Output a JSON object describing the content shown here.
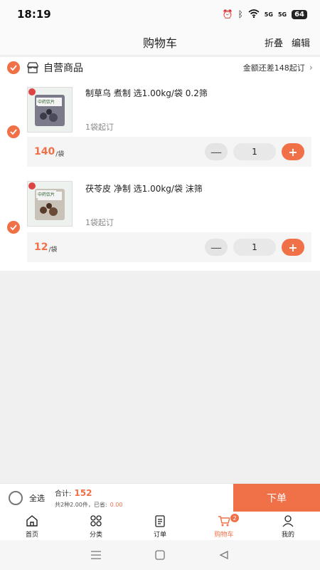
{
  "status": {
    "time": "18:19",
    "battery": "64",
    "net1": "5G",
    "net2": "5G"
  },
  "header": {
    "title": "购物车",
    "fold_label": "折叠",
    "edit_label": "编辑"
  },
  "store": {
    "name": "自营商品",
    "hint": "金额还差148起订"
  },
  "items": [
    {
      "name": "制草乌 煮制 选1.00kg/袋 0.2筛",
      "moq": "1袋起订",
      "price": "140",
      "unit": "/袋",
      "qty": "1",
      "thumb_label": "中药饮片"
    },
    {
      "name": "茯苓皮 净制 选1.00kg/袋 沫筛",
      "moq": "1袋起订",
      "price": "12",
      "unit": "/袋",
      "qty": "1",
      "thumb_label": "中药饮片"
    }
  ],
  "footer": {
    "select_all": "全选",
    "total_label": "合计:",
    "total_value": "152",
    "summary": "共2种2.00件，已省:",
    "saved": "0.00",
    "order_label": "下单"
  },
  "tabs": [
    {
      "label": "首页",
      "icon": "home-icon"
    },
    {
      "label": "分类",
      "icon": "category-icon"
    },
    {
      "label": "订单",
      "icon": "order-icon"
    },
    {
      "label": "购物车",
      "icon": "cart-icon",
      "badge": "2"
    },
    {
      "label": "我的",
      "icon": "profile-icon"
    }
  ],
  "colors": {
    "accent": "#f07048"
  }
}
